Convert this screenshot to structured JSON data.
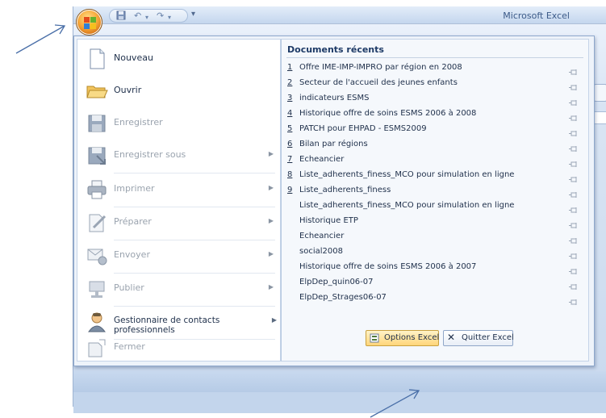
{
  "window": {
    "title": "Microsoft Excel"
  },
  "quick_access": {
    "icons": [
      "save-icon",
      "undo-icon",
      "redo-icon",
      "customize-icon"
    ],
    "undo_glyph": "↶",
    "redo_glyph": "↷",
    "more_glyph": "▾"
  },
  "menu": {
    "commands": [
      {
        "label": "Nouveau",
        "icon": "new-document-icon",
        "enabled": true,
        "submenu": false
      },
      {
        "label": "Ouvrir",
        "icon": "open-folder-icon",
        "enabled": true,
        "submenu": false
      },
      {
        "label": "Enregistrer",
        "icon": "save-icon",
        "enabled": false,
        "submenu": false
      },
      {
        "label": "Enregistrer sous",
        "icon": "save-as-icon",
        "enabled": false,
        "submenu": true
      },
      {
        "label": "Imprimer",
        "icon": "printer-icon",
        "enabled": false,
        "submenu": true
      },
      {
        "label": "Préparer",
        "icon": "prepare-icon",
        "enabled": false,
        "submenu": true
      },
      {
        "label": "Envoyer",
        "icon": "send-icon",
        "enabled": false,
        "submenu": true
      },
      {
        "label": "Publier",
        "icon": "publish-icon",
        "enabled": false,
        "submenu": true
      },
      {
        "label": "Gestionnaire de contacts professionnels",
        "icon": "contact-manager-icon",
        "enabled": true,
        "submenu": true
      },
      {
        "label": "Fermer",
        "icon": "close-document-icon",
        "enabled": false,
        "submenu": false
      }
    ],
    "submenu_glyph": "▶",
    "recent": {
      "header": "Documents récents",
      "items": [
        {
          "num": "1",
          "name": "Offre IME-IMP-IMPRO par région en 2008"
        },
        {
          "num": "2",
          "name": "Secteur de l'accueil des jeunes enfants"
        },
        {
          "num": "3",
          "name": "indicateurs ESMS"
        },
        {
          "num": "4",
          "name": "Historique offre de soins ESMS 2006 à 2008"
        },
        {
          "num": "5",
          "name": "PATCH pour EHPAD - ESMS2009"
        },
        {
          "num": "6",
          "name": "Bilan par régions"
        },
        {
          "num": "7",
          "name": "Echeancier"
        },
        {
          "num": "8",
          "name": "Liste_adherents_finess_MCO pour simulation en ligne"
        },
        {
          "num": "9",
          "name": "Liste_adherents_finess"
        },
        {
          "num": "",
          "name": "Liste_adherents_finess_MCO pour simulation en ligne"
        },
        {
          "num": "",
          "name": "Historique ETP"
        },
        {
          "num": "",
          "name": "Echeancier"
        },
        {
          "num": "",
          "name": "social2008"
        },
        {
          "num": "",
          "name": "Historique offre de soins ESMS 2006 à 2007"
        },
        {
          "num": "",
          "name": "ElpDep_quin06-07"
        },
        {
          "num": "",
          "name": "ElpDep_Strages06-07"
        }
      ]
    },
    "footer": {
      "options_label": "Options Excel",
      "quit_label": "Quitter Excel",
      "quit_glyph": "✕"
    }
  },
  "colors": {
    "office_button": "#f7a83a",
    "menu_border": "#8ea8cc",
    "arrow": "#4a6fa8",
    "options_highlight": "#ffd57a"
  }
}
